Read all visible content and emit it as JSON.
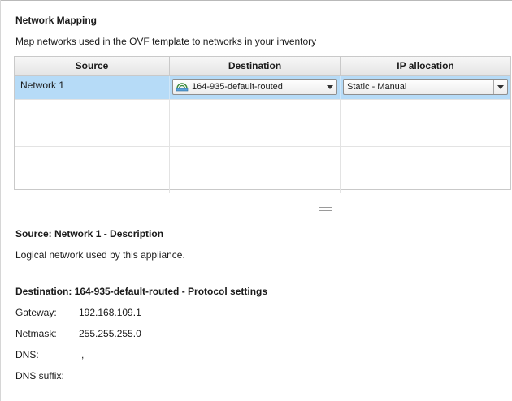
{
  "section": {
    "title": "Network Mapping",
    "intro": "Map networks used in the OVF template to networks in your inventory"
  },
  "grid": {
    "columns": [
      "Source",
      "Destination",
      "IP allocation"
    ],
    "rows": [
      {
        "source": "Network 1",
        "destination": "164-935-default-routed",
        "ip_allocation": "Static - Manual",
        "selected": true
      }
    ],
    "empty_rows": 4,
    "destination_icon": "network-icon",
    "dropdown_icon": "dropdown-arrow-icon",
    "selection_color": "#b6dbf7"
  },
  "source_description": {
    "title": "Source: Network 1 - Description",
    "text": "Logical network used by this appliance."
  },
  "destination_settings": {
    "title": "Destination: 164-935-default-routed - Protocol settings",
    "fields": [
      {
        "label": "Gateway:",
        "value": "192.168.109.1"
      },
      {
        "label": "Netmask:",
        "value": "255.255.255.0"
      },
      {
        "label": "DNS:",
        "value": ","
      },
      {
        "label": "DNS suffix:",
        "value": ""
      }
    ]
  }
}
